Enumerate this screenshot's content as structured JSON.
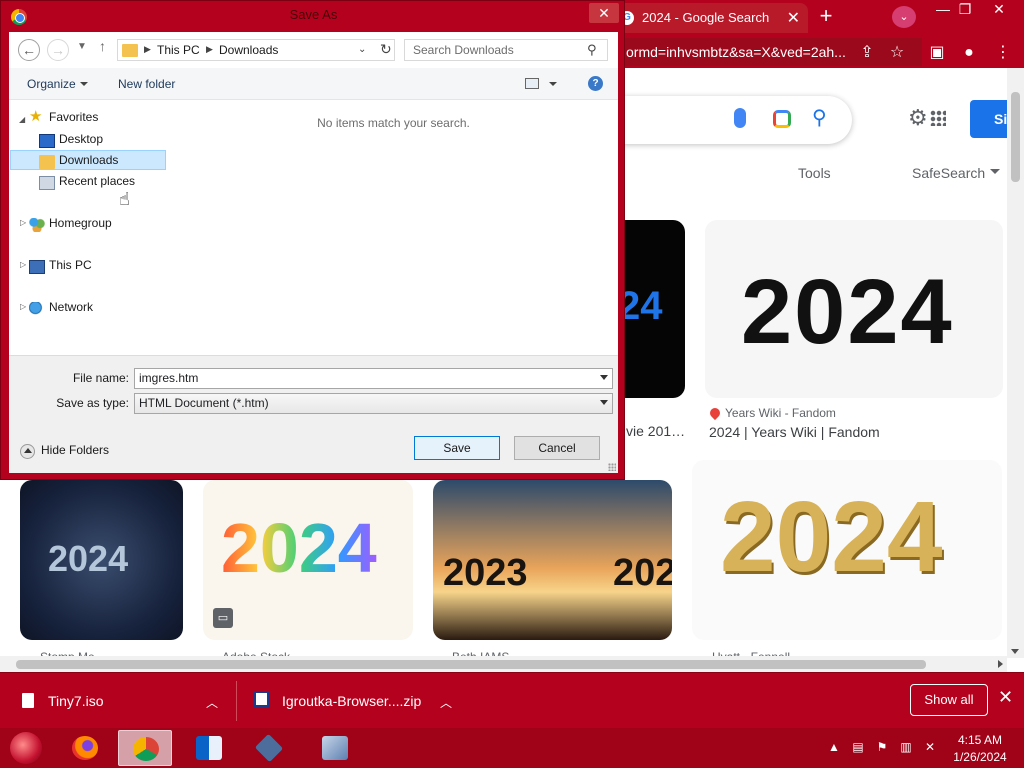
{
  "chrome": {
    "tab": {
      "title": "2024 - Google Search",
      "close": "✕"
    },
    "new_tab": "+",
    "omnibox_text": "ormd=inhvsmbtz&sa=X&ved=2ah...",
    "window_controls": {
      "minimize": "—",
      "maximize": "❐",
      "close": "✕"
    },
    "toolbar_icons": [
      "share-icon",
      "star-icon",
      "sidebar-icon",
      "profile-icon",
      "menu-icon"
    ]
  },
  "google": {
    "sign_in_label": "Si",
    "tools_label": "Tools",
    "safesearch_label": "SafeSearch",
    "results": [
      {
        "source": "Years Wiki - Fandom",
        "title": "2024 | Years Wiki | Fandom",
        "image_text": "2024"
      },
      {
        "partial_title": "vie 201…",
        "image_text": "24"
      }
    ],
    "thumbs": [
      {
        "image_text": "2024",
        "source": "Stomp Me"
      },
      {
        "image_text": "2024",
        "source": "Adobe Stock"
      },
      {
        "image_text_left": "2023",
        "image_text_right": "202",
        "source": "Beth IAMS"
      },
      {
        "image_text": "2024",
        "source": "Hyatt - Fennell"
      }
    ]
  },
  "downloads": {
    "items": [
      {
        "name": "Tiny7.iso"
      },
      {
        "name": "Igroutka-Browser....zip"
      }
    ],
    "show_all": "Show all",
    "close": "✕"
  },
  "taskbar": {
    "apps": [
      "firefox-icon",
      "chrome-icon",
      "outlook-icon",
      "virtualbox-icon",
      "tiny7-icon"
    ],
    "clock_time": "4:15 AM",
    "clock_date": "1/26/2024"
  },
  "dialog": {
    "title": "Save As",
    "close": "✕",
    "address": {
      "segments": [
        "This PC",
        "Downloads"
      ]
    },
    "search_placeholder": "Search Downloads",
    "organize_label": "Organize",
    "new_folder_label": "New folder",
    "tree": {
      "favorites": "Favorites",
      "desktop": "Desktop",
      "downloads": "Downloads",
      "recent": "Recent places",
      "homegroup": "Homegroup",
      "this_pc": "This PC",
      "network": "Network"
    },
    "empty_message": "No items match your search.",
    "file_name_label": "File name:",
    "file_name_value": "imgres.htm",
    "save_type_label": "Save as type:",
    "save_type_value": "HTML Document (*.htm)",
    "hide_folders_label": "Hide Folders",
    "save_label": "Save",
    "cancel_label": "Cancel"
  }
}
